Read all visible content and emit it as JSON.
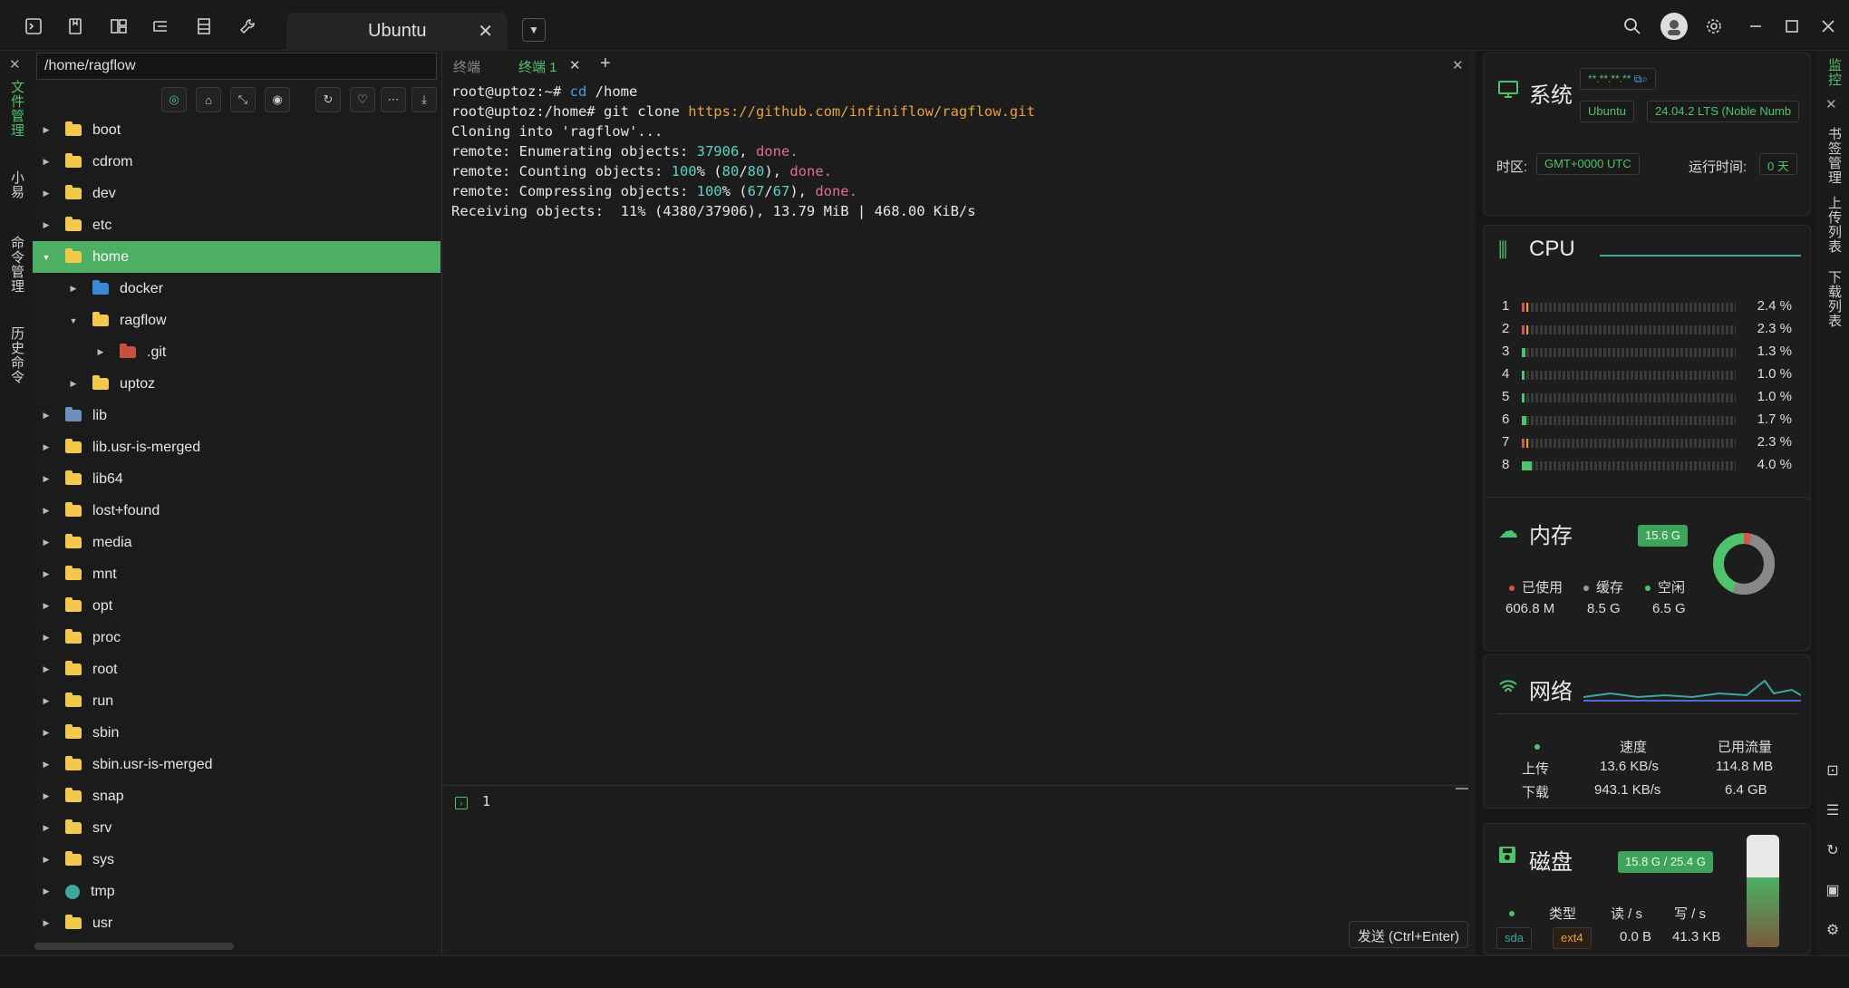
{
  "titlebar": {
    "tab_title": "Ubuntu",
    "tab_close": "✕",
    "window_controls": [
      "minimize-icon",
      "maximize-icon",
      "close-icon"
    ]
  },
  "left_strip": {
    "items": [
      "文件管理",
      "小易",
      "命令管理",
      "历史命令"
    ],
    "close": "✕"
  },
  "file_panel": {
    "path": "/home/ragflow",
    "tree": [
      {
        "name": "boot",
        "depth": 0,
        "icon": "folder",
        "expanded": false
      },
      {
        "name": "cdrom",
        "depth": 0,
        "icon": "folder",
        "expanded": false
      },
      {
        "name": "dev",
        "depth": 0,
        "icon": "folder",
        "expanded": false
      },
      {
        "name": "etc",
        "depth": 0,
        "icon": "folder",
        "expanded": false
      },
      {
        "name": "home",
        "depth": 0,
        "icon": "folder",
        "expanded": true,
        "selected": true
      },
      {
        "name": "docker",
        "depth": 1,
        "icon": "docker",
        "expanded": false
      },
      {
        "name": "ragflow",
        "depth": 1,
        "icon": "folder",
        "expanded": true
      },
      {
        "name": ".git",
        "depth": 2,
        "icon": "git",
        "expanded": false
      },
      {
        "name": "uptoz",
        "depth": 1,
        "icon": "folder",
        "expanded": false
      },
      {
        "name": "lib",
        "depth": 0,
        "icon": "lib",
        "expanded": false
      },
      {
        "name": "lib.usr-is-merged",
        "depth": 0,
        "icon": "folder",
        "expanded": false
      },
      {
        "name": "lib64",
        "depth": 0,
        "icon": "folder",
        "expanded": false
      },
      {
        "name": "lost+found",
        "depth": 0,
        "icon": "folder",
        "expanded": false
      },
      {
        "name": "media",
        "depth": 0,
        "icon": "folder",
        "expanded": false
      },
      {
        "name": "mnt",
        "depth": 0,
        "icon": "folder",
        "expanded": false
      },
      {
        "name": "opt",
        "depth": 0,
        "icon": "folder",
        "expanded": false
      },
      {
        "name": "proc",
        "depth": 0,
        "icon": "folder",
        "expanded": false
      },
      {
        "name": "root",
        "depth": 0,
        "icon": "folder",
        "expanded": false
      },
      {
        "name": "run",
        "depth": 0,
        "icon": "folder",
        "expanded": false
      },
      {
        "name": "sbin",
        "depth": 0,
        "icon": "folder",
        "expanded": false
      },
      {
        "name": "sbin.usr-is-merged",
        "depth": 0,
        "icon": "folder",
        "expanded": false
      },
      {
        "name": "snap",
        "depth": 0,
        "icon": "folder",
        "expanded": false
      },
      {
        "name": "srv",
        "depth": 0,
        "icon": "folder",
        "expanded": false
      },
      {
        "name": "sys",
        "depth": 0,
        "icon": "folder",
        "expanded": false
      },
      {
        "name": "tmp",
        "depth": 0,
        "icon": "tmp",
        "expanded": false
      },
      {
        "name": "usr",
        "depth": 0,
        "icon": "folder",
        "expanded": false
      }
    ]
  },
  "terminal": {
    "tabs": [
      "终端",
      "终端 1"
    ],
    "add": "+",
    "close": "✕",
    "lines": [
      [
        {
          "t": "root@uptoz:~# "
        },
        {
          "t": "cd",
          "c": "c-blue"
        },
        {
          "t": " /home"
        }
      ],
      [
        {
          "t": "root@uptoz:/home# git clone "
        },
        {
          "t": "https://github.com/infiniflow/ragflow.git",
          "c": "c-orange"
        }
      ],
      [
        {
          "t": "Cloning into 'ragflow'..."
        }
      ],
      [
        {
          "t": "remote: Enumerating objects: "
        },
        {
          "t": "37906",
          "c": "c-cyan"
        },
        {
          "t": ", "
        },
        {
          "t": "done.",
          "c": "c-pink"
        }
      ],
      [
        {
          "t": "remote: Counting objects: "
        },
        {
          "t": "100",
          "c": "c-cyan"
        },
        {
          "t": "% ("
        },
        {
          "t": "80",
          "c": "c-cyan"
        },
        {
          "t": "/"
        },
        {
          "t": "80",
          "c": "c-cyan"
        },
        {
          "t": "), "
        },
        {
          "t": "done.",
          "c": "c-pink"
        }
      ],
      [
        {
          "t": "remote: Compressing objects: "
        },
        {
          "t": "100",
          "c": "c-cyan"
        },
        {
          "t": "% ("
        },
        {
          "t": "67",
          "c": "c-cyan"
        },
        {
          "t": "/"
        },
        {
          "t": "67",
          "c": "c-cyan"
        },
        {
          "t": "), "
        },
        {
          "t": "done.",
          "c": "c-pink"
        }
      ],
      [
        {
          "t": "Receiving objects:  11% (4380/37906), 13.79 MiB | 468.00 KiB/s"
        }
      ]
    ],
    "input_line_no": "1",
    "send_label": "发送 (Ctrl+Enter)"
  },
  "monitor": {
    "system": {
      "title": "系统",
      "ip": "**.**.**.**",
      "os": "Ubuntu",
      "version": "24.04.2 LTS (Noble Numb",
      "tz_label": "时区:",
      "tz_value": "GMT+0000   UTC",
      "uptime_label": "运行时间:",
      "uptime_value": "0 天"
    },
    "cpu": {
      "title": "CPU",
      "cores": [
        {
          "n": "1",
          "pct": "2.4 %",
          "v": 2.4
        },
        {
          "n": "2",
          "pct": "2.3 %",
          "v": 2.3
        },
        {
          "n": "3",
          "pct": "1.3 %",
          "v": 1.3
        },
        {
          "n": "4",
          "pct": "1.0 %",
          "v": 1.0
        },
        {
          "n": "5",
          "pct": "1.0 %",
          "v": 1.0
        },
        {
          "n": "6",
          "pct": "1.7 %",
          "v": 1.7
        },
        {
          "n": "7",
          "pct": "2.3 %",
          "v": 2.3
        },
        {
          "n": "8",
          "pct": "4.0 %",
          "v": 4.0
        }
      ]
    },
    "memory": {
      "title": "内存",
      "total": "15.6 G",
      "used_label": "已使用",
      "used": "606.8 M",
      "cache_label": "缓存",
      "cache": "8.5 G",
      "free_label": "空闲",
      "free": "6.5 G"
    },
    "network": {
      "title": "网络",
      "speed_label": "速度",
      "traffic_label": "已用流量",
      "up_label": "上传",
      "up_speed": "13.6 KB/s",
      "up_traffic": "114.8 MB",
      "down_label": "下载",
      "down_speed": "943.1 KB/s",
      "down_traffic": "6.4 GB"
    },
    "disk": {
      "title": "磁盘",
      "usage": "15.8 G / 25.4 G",
      "type_label": "类型",
      "read_label": "读 / s",
      "write_label": "写 / s",
      "device": "sda",
      "fs": "ext4",
      "read": "0.0 B",
      "write": "41.3 KB",
      "fill": 0.62
    }
  },
  "right_strip": {
    "items": [
      "监控",
      "书签管理",
      "上传列表",
      "下载列表"
    ],
    "close": "✕"
  },
  "colors": {
    "accent": "#4fc36b",
    "selected_row": "#4caf63",
    "link": "#e8a23b",
    "number": "#56d4c8",
    "done": "#e06c9f"
  }
}
